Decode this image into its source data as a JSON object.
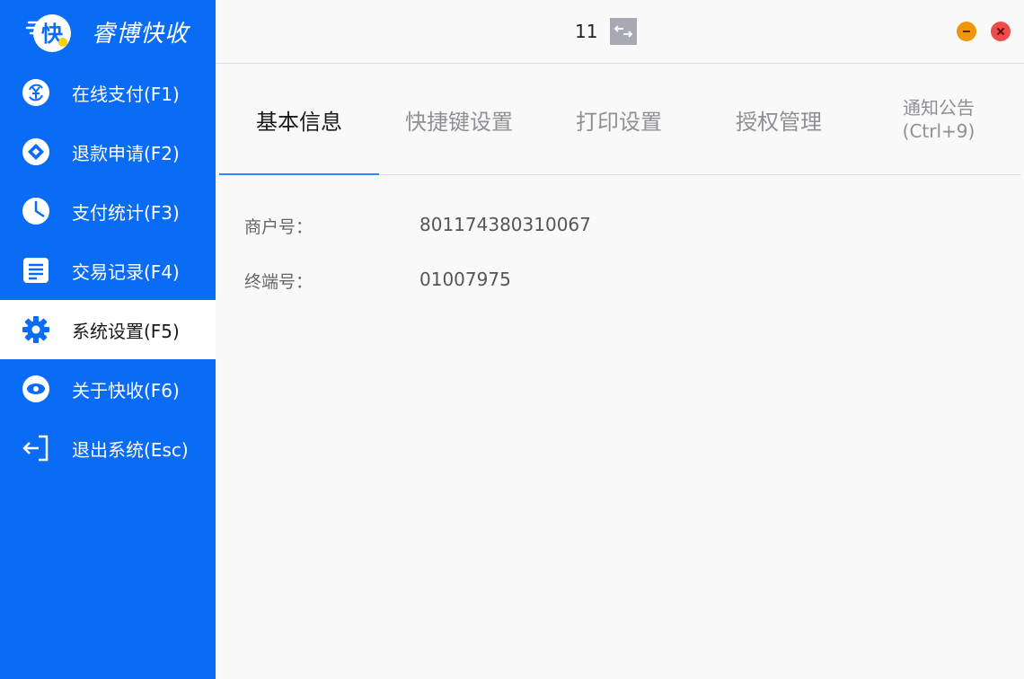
{
  "app": {
    "logo_text": "快",
    "name": "睿博快收"
  },
  "sidebar": {
    "items": [
      {
        "label": "在线支付(F1)",
        "icon": "yen-refresh-icon"
      },
      {
        "label": "退款申请(F2)",
        "icon": "refund-icon"
      },
      {
        "label": "支付统计(F3)",
        "icon": "pie-chart-icon"
      },
      {
        "label": "交易记录(F4)",
        "icon": "document-icon"
      },
      {
        "label": "系统设置(F5)",
        "icon": "gear-icon",
        "active": true
      },
      {
        "label": "关于快收(F6)",
        "icon": "eye-icon"
      },
      {
        "label": "退出系统(Esc)",
        "icon": "logout-icon"
      }
    ]
  },
  "topbar": {
    "counter": "11",
    "swap_icon": "swap-arrows-icon"
  },
  "tabs": [
    {
      "label": "基本信息",
      "active": true
    },
    {
      "label": "快捷键设置"
    },
    {
      "label": "打印设置"
    },
    {
      "label": "授权管理"
    },
    {
      "label_line1": "通知公告",
      "label_line2": "(Ctrl+9)"
    }
  ],
  "basic_info": {
    "merchant_label": "商户号：",
    "merchant_value": "801174380310067",
    "terminal_label": "终端号：",
    "terminal_value": "01007975"
  },
  "colors": {
    "sidebar_bg": "#0a6cf4",
    "minimize": "#f0960c",
    "close": "#ef4b4b",
    "tab_indicator": "#2f86ff"
  }
}
